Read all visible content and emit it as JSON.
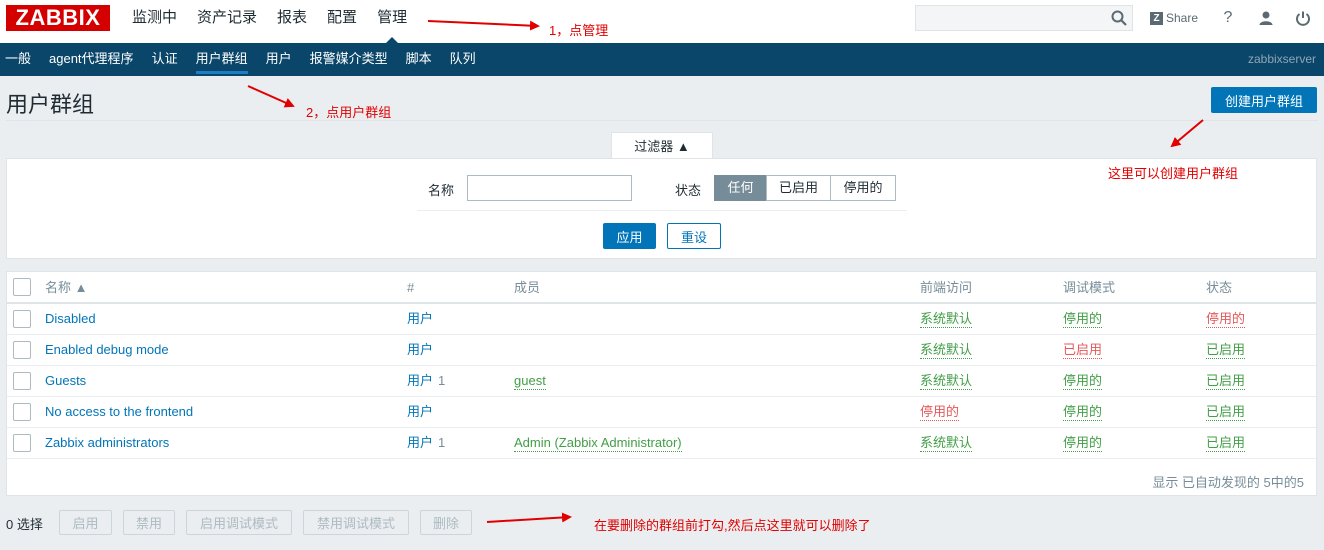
{
  "logo": "ZABBIX",
  "main_nav": [
    "监测中",
    "资产记录",
    "报表",
    "配置",
    "管理"
  ],
  "search": {
    "value": "",
    "placeholder": ""
  },
  "top_actions": {
    "share": "Share",
    "help": "?"
  },
  "sub_nav": [
    "一般",
    "agent代理程序",
    "认证",
    "用户群组",
    "用户",
    "报警媒介类型",
    "脚本",
    "队列"
  ],
  "server_name": "zabbixserver",
  "page_title": "用户群组",
  "create_button": "创建用户群组",
  "filter": {
    "tab_label": "过滤器 ▲",
    "name_label": "名称",
    "name_value": "",
    "status_label": "状态",
    "status_options": [
      "任何",
      "已启用",
      "停用的"
    ],
    "selected_status": "任何",
    "apply": "应用",
    "reset": "重设"
  },
  "table": {
    "headers": {
      "name": "名称 ▲",
      "count": "#",
      "members": "成员",
      "frontend": "前端访问",
      "debug": "调试模式",
      "status": "状态"
    },
    "rows": [
      {
        "name": "Disabled",
        "users": "用户",
        "count": "",
        "members": "",
        "frontend": "系统默认",
        "debug": "停用的",
        "status": "停用的"
      },
      {
        "name": "Enabled debug mode",
        "users": "用户",
        "count": "",
        "members": "",
        "frontend": "系统默认",
        "debug": "已启用",
        "status": "已启用"
      },
      {
        "name": "Guests",
        "users": "用户",
        "count": "1",
        "members": "guest",
        "frontend": "系统默认",
        "debug": "停用的",
        "status": "已启用"
      },
      {
        "name": "No access to the frontend",
        "users": "用户",
        "count": "",
        "members": "",
        "frontend": "停用的",
        "debug": "停用的",
        "status": "已启用"
      },
      {
        "name": "Zabbix administrators",
        "users": "用户",
        "count": "1",
        "members": "Admin (Zabbix Administrator)",
        "frontend": "系统默认",
        "debug": "停用的",
        "status": "已启用"
      }
    ],
    "footer": "显示 已自动发现的 5中的5"
  },
  "bottom": {
    "selected": "0 选择",
    "actions": [
      "启用",
      "禁用",
      "启用调试模式",
      "禁用调试模式",
      "删除"
    ]
  },
  "annotations": {
    "step1": "1，点管理",
    "step2": "2，点用户群组",
    "create_hint": "这里可以创建用户群组",
    "delete_hint": "在要删除的群组前打勾,然后点这里就可以删除了"
  },
  "colors": {
    "brand": "#d40000",
    "nav": "#0a466a",
    "primary": "#0275b8",
    "green": "#429e47",
    "red": "#e45959",
    "annotation": "#e00000"
  }
}
